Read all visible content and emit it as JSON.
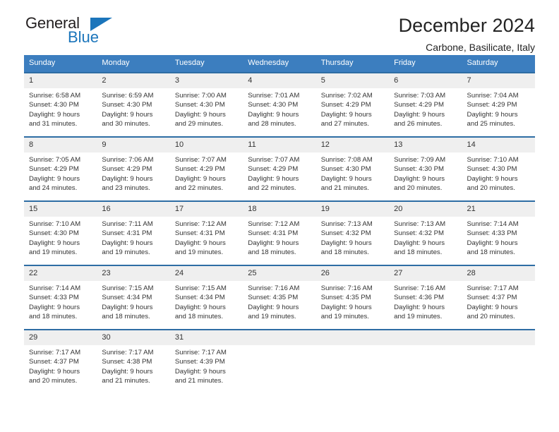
{
  "logo": {
    "primary_text": "General",
    "secondary_text": "Blue",
    "triangle_icon": "triangle-icon",
    "primary_color": "#231f20",
    "secondary_color": "#1b75bb"
  },
  "header": {
    "title": "December 2024",
    "subtitle": "Carbone, Basilicate, Italy"
  },
  "theme": {
    "header_bg": "#3c7ebf",
    "row_divider": "#2e6da4",
    "daynum_bg": "#efefef",
    "text": "#333333"
  },
  "weekday_headers": [
    "Sunday",
    "Monday",
    "Tuesday",
    "Wednesday",
    "Thursday",
    "Friday",
    "Saturday"
  ],
  "weeks": [
    [
      {
        "day": "1",
        "sunrise": "Sunrise: 6:58 AM",
        "sunset": "Sunset: 4:30 PM",
        "daylight_1": "Daylight: 9 hours",
        "daylight_2": "and 31 minutes."
      },
      {
        "day": "2",
        "sunrise": "Sunrise: 6:59 AM",
        "sunset": "Sunset: 4:30 PM",
        "daylight_1": "Daylight: 9 hours",
        "daylight_2": "and 30 minutes."
      },
      {
        "day": "3",
        "sunrise": "Sunrise: 7:00 AM",
        "sunset": "Sunset: 4:30 PM",
        "daylight_1": "Daylight: 9 hours",
        "daylight_2": "and 29 minutes."
      },
      {
        "day": "4",
        "sunrise": "Sunrise: 7:01 AM",
        "sunset": "Sunset: 4:30 PM",
        "daylight_1": "Daylight: 9 hours",
        "daylight_2": "and 28 minutes."
      },
      {
        "day": "5",
        "sunrise": "Sunrise: 7:02 AM",
        "sunset": "Sunset: 4:29 PM",
        "daylight_1": "Daylight: 9 hours",
        "daylight_2": "and 27 minutes."
      },
      {
        "day": "6",
        "sunrise": "Sunrise: 7:03 AM",
        "sunset": "Sunset: 4:29 PM",
        "daylight_1": "Daylight: 9 hours",
        "daylight_2": "and 26 minutes."
      },
      {
        "day": "7",
        "sunrise": "Sunrise: 7:04 AM",
        "sunset": "Sunset: 4:29 PM",
        "daylight_1": "Daylight: 9 hours",
        "daylight_2": "and 25 minutes."
      }
    ],
    [
      {
        "day": "8",
        "sunrise": "Sunrise: 7:05 AM",
        "sunset": "Sunset: 4:29 PM",
        "daylight_1": "Daylight: 9 hours",
        "daylight_2": "and 24 minutes."
      },
      {
        "day": "9",
        "sunrise": "Sunrise: 7:06 AM",
        "sunset": "Sunset: 4:29 PM",
        "daylight_1": "Daylight: 9 hours",
        "daylight_2": "and 23 minutes."
      },
      {
        "day": "10",
        "sunrise": "Sunrise: 7:07 AM",
        "sunset": "Sunset: 4:29 PM",
        "daylight_1": "Daylight: 9 hours",
        "daylight_2": "and 22 minutes."
      },
      {
        "day": "11",
        "sunrise": "Sunrise: 7:07 AM",
        "sunset": "Sunset: 4:29 PM",
        "daylight_1": "Daylight: 9 hours",
        "daylight_2": "and 22 minutes."
      },
      {
        "day": "12",
        "sunrise": "Sunrise: 7:08 AM",
        "sunset": "Sunset: 4:30 PM",
        "daylight_1": "Daylight: 9 hours",
        "daylight_2": "and 21 minutes."
      },
      {
        "day": "13",
        "sunrise": "Sunrise: 7:09 AM",
        "sunset": "Sunset: 4:30 PM",
        "daylight_1": "Daylight: 9 hours",
        "daylight_2": "and 20 minutes."
      },
      {
        "day": "14",
        "sunrise": "Sunrise: 7:10 AM",
        "sunset": "Sunset: 4:30 PM",
        "daylight_1": "Daylight: 9 hours",
        "daylight_2": "and 20 minutes."
      }
    ],
    [
      {
        "day": "15",
        "sunrise": "Sunrise: 7:10 AM",
        "sunset": "Sunset: 4:30 PM",
        "daylight_1": "Daylight: 9 hours",
        "daylight_2": "and 19 minutes."
      },
      {
        "day": "16",
        "sunrise": "Sunrise: 7:11 AM",
        "sunset": "Sunset: 4:31 PM",
        "daylight_1": "Daylight: 9 hours",
        "daylight_2": "and 19 minutes."
      },
      {
        "day": "17",
        "sunrise": "Sunrise: 7:12 AM",
        "sunset": "Sunset: 4:31 PM",
        "daylight_1": "Daylight: 9 hours",
        "daylight_2": "and 19 minutes."
      },
      {
        "day": "18",
        "sunrise": "Sunrise: 7:12 AM",
        "sunset": "Sunset: 4:31 PM",
        "daylight_1": "Daylight: 9 hours",
        "daylight_2": "and 18 minutes."
      },
      {
        "day": "19",
        "sunrise": "Sunrise: 7:13 AM",
        "sunset": "Sunset: 4:32 PM",
        "daylight_1": "Daylight: 9 hours",
        "daylight_2": "and 18 minutes."
      },
      {
        "day": "20",
        "sunrise": "Sunrise: 7:13 AM",
        "sunset": "Sunset: 4:32 PM",
        "daylight_1": "Daylight: 9 hours",
        "daylight_2": "and 18 minutes."
      },
      {
        "day": "21",
        "sunrise": "Sunrise: 7:14 AM",
        "sunset": "Sunset: 4:33 PM",
        "daylight_1": "Daylight: 9 hours",
        "daylight_2": "and 18 minutes."
      }
    ],
    [
      {
        "day": "22",
        "sunrise": "Sunrise: 7:14 AM",
        "sunset": "Sunset: 4:33 PM",
        "daylight_1": "Daylight: 9 hours",
        "daylight_2": "and 18 minutes."
      },
      {
        "day": "23",
        "sunrise": "Sunrise: 7:15 AM",
        "sunset": "Sunset: 4:34 PM",
        "daylight_1": "Daylight: 9 hours",
        "daylight_2": "and 18 minutes."
      },
      {
        "day": "24",
        "sunrise": "Sunrise: 7:15 AM",
        "sunset": "Sunset: 4:34 PM",
        "daylight_1": "Daylight: 9 hours",
        "daylight_2": "and 18 minutes."
      },
      {
        "day": "25",
        "sunrise": "Sunrise: 7:16 AM",
        "sunset": "Sunset: 4:35 PM",
        "daylight_1": "Daylight: 9 hours",
        "daylight_2": "and 19 minutes."
      },
      {
        "day": "26",
        "sunrise": "Sunrise: 7:16 AM",
        "sunset": "Sunset: 4:35 PM",
        "daylight_1": "Daylight: 9 hours",
        "daylight_2": "and 19 minutes."
      },
      {
        "day": "27",
        "sunrise": "Sunrise: 7:16 AM",
        "sunset": "Sunset: 4:36 PM",
        "daylight_1": "Daylight: 9 hours",
        "daylight_2": "and 19 minutes."
      },
      {
        "day": "28",
        "sunrise": "Sunrise: 7:17 AM",
        "sunset": "Sunset: 4:37 PM",
        "daylight_1": "Daylight: 9 hours",
        "daylight_2": "and 20 minutes."
      }
    ],
    [
      {
        "day": "29",
        "sunrise": "Sunrise: 7:17 AM",
        "sunset": "Sunset: 4:37 PM",
        "daylight_1": "Daylight: 9 hours",
        "daylight_2": "and 20 minutes."
      },
      {
        "day": "30",
        "sunrise": "Sunrise: 7:17 AM",
        "sunset": "Sunset: 4:38 PM",
        "daylight_1": "Daylight: 9 hours",
        "daylight_2": "and 21 minutes."
      },
      {
        "day": "31",
        "sunrise": "Sunrise: 7:17 AM",
        "sunset": "Sunset: 4:39 PM",
        "daylight_1": "Daylight: 9 hours",
        "daylight_2": "and 21 minutes."
      },
      {
        "day": "",
        "sunrise": "",
        "sunset": "",
        "daylight_1": "",
        "daylight_2": ""
      },
      {
        "day": "",
        "sunrise": "",
        "sunset": "",
        "daylight_1": "",
        "daylight_2": ""
      },
      {
        "day": "",
        "sunrise": "",
        "sunset": "",
        "daylight_1": "",
        "daylight_2": ""
      },
      {
        "day": "",
        "sunrise": "",
        "sunset": "",
        "daylight_1": "",
        "daylight_2": ""
      }
    ]
  ]
}
